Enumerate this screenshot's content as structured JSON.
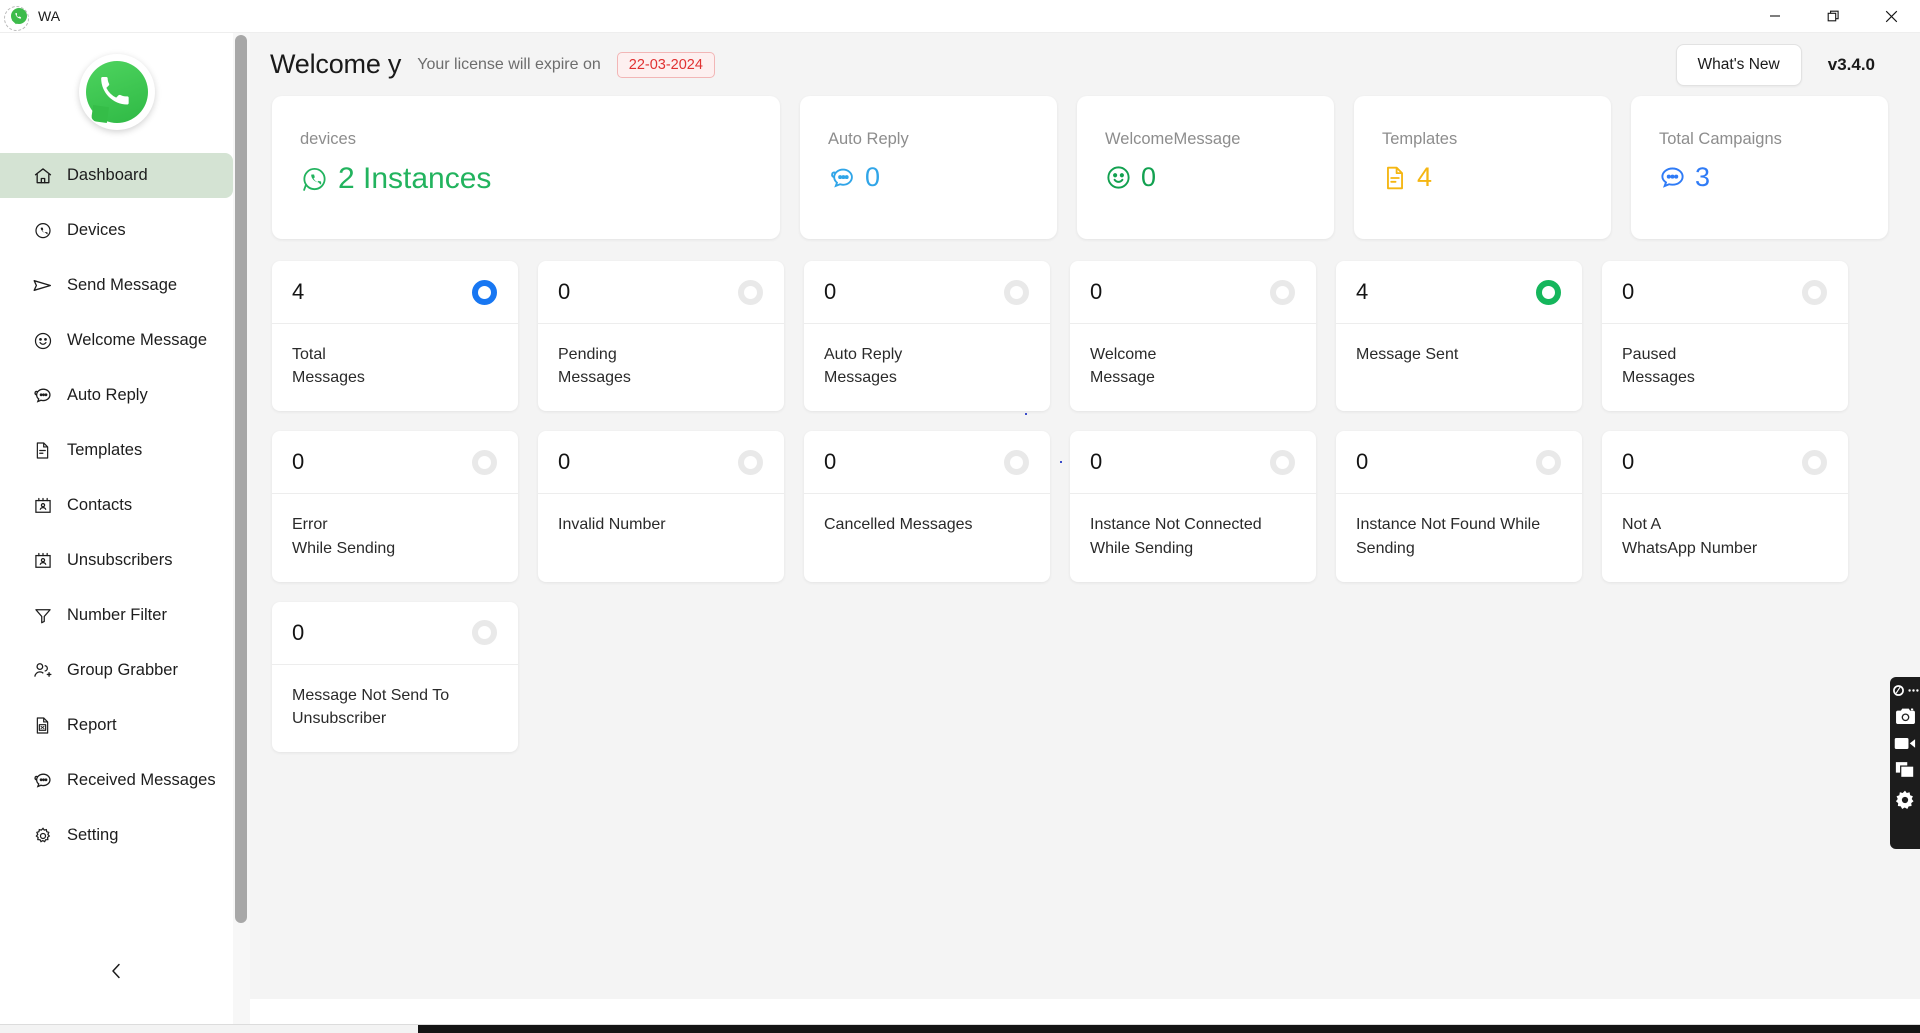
{
  "titlebar": {
    "app_name": "WA",
    "logo_icon": "whatsapp-icon",
    "minimize_label": "Minimize",
    "restore_label": "Restore",
    "close_label": "Close"
  },
  "sidebar": {
    "logo_icon": "whatsapp-logo",
    "collapse_label": "<",
    "items": [
      {
        "label": "Dashboard",
        "icon": "home-icon",
        "active": true
      },
      {
        "label": "Devices",
        "icon": "whatsapp-icon",
        "active": false
      },
      {
        "label": "Send Message",
        "icon": "send-icon",
        "active": false
      },
      {
        "label": "Welcome Message",
        "icon": "smiley-icon",
        "active": false
      },
      {
        "label": "Auto Reply",
        "icon": "chat-icon",
        "active": false
      },
      {
        "label": "Templates",
        "icon": "document-icon",
        "active": false
      },
      {
        "label": "Contacts",
        "icon": "contact-card-icon",
        "active": false
      },
      {
        "label": "Unsubscribers",
        "icon": "contact-card-icon",
        "active": false
      },
      {
        "label": "Number Filter",
        "icon": "funnel-icon",
        "active": false
      },
      {
        "label": "Group Grabber",
        "icon": "user-add-icon",
        "active": false
      },
      {
        "label": "Report",
        "icon": "file-excel-icon",
        "active": false
      },
      {
        "label": "Received Messages",
        "icon": "chat-icon",
        "active": false
      },
      {
        "label": "Setting",
        "icon": "gear-icon",
        "active": false
      }
    ]
  },
  "header": {
    "welcome": "Welcome y",
    "license_text": "Your license will expire on",
    "license_date": "22-03-2024",
    "license_date_color": "#e03131",
    "whats_new": "What's New",
    "version": "v3.4.0"
  },
  "summary_cards": [
    {
      "title": "devices",
      "value": "2 Instances",
      "icon": "whatsapp-icon",
      "color": "#22b35e",
      "wide": true
    },
    {
      "title": "Auto Reply",
      "value": "0",
      "icon": "chat-icon",
      "color": "#30a5e8",
      "wide": false
    },
    {
      "title": "WelcomeMessage",
      "value": "0",
      "icon": "smiley-icon",
      "color": "#12a150",
      "wide": false
    },
    {
      "title": "Templates",
      "value": "4",
      "icon": "document-icon",
      "color": "#f5b611",
      "wide": false
    },
    {
      "title": "Total Campaigns",
      "value": "3",
      "icon": "chat-dots-icon",
      "color": "#2f7bf6",
      "wide": false
    }
  ],
  "stats": [
    {
      "value": "4",
      "label": "Total\nMessages",
      "ring": "blue"
    },
    {
      "value": "0",
      "label": "Pending\nMessages",
      "ring": "grey"
    },
    {
      "value": "0",
      "label": "Auto Reply\nMessages",
      "ring": "grey"
    },
    {
      "value": "0",
      "label": "Welcome\nMessage",
      "ring": "grey"
    },
    {
      "value": "4",
      "label": "Message Sent",
      "ring": "green"
    },
    {
      "value": "0",
      "label": "Paused\nMessages",
      "ring": "grey"
    },
    {
      "value": "0",
      "label": "Error\nWhile Sending",
      "ring": "grey"
    },
    {
      "value": "0",
      "label": "Invalid Number",
      "ring": "grey"
    },
    {
      "value": "0",
      "label": "Cancelled Messages",
      "ring": "grey"
    },
    {
      "value": "0",
      "label": "Instance Not Connected\nWhile Sending",
      "ring": "grey"
    },
    {
      "value": "0",
      "label": "Instance Not Found While\nSending",
      "ring": "grey"
    },
    {
      "value": "0",
      "label": "Not A\nWhatsApp Number",
      "ring": "grey"
    },
    {
      "value": "0",
      "label": "Message Not Send To\nUnsubscriber",
      "ring": "grey"
    }
  ],
  "float_toolbar": {
    "background": "#1c1c1c",
    "items": [
      {
        "icon": "app-badge-icon",
        "label": "menu"
      },
      {
        "icon": "camera-icon",
        "label": "screenshot"
      },
      {
        "icon": "video-icon",
        "label": "record"
      },
      {
        "icon": "windows-icon",
        "label": "windows"
      },
      {
        "icon": "gear-icon",
        "label": "settings"
      }
    ]
  }
}
